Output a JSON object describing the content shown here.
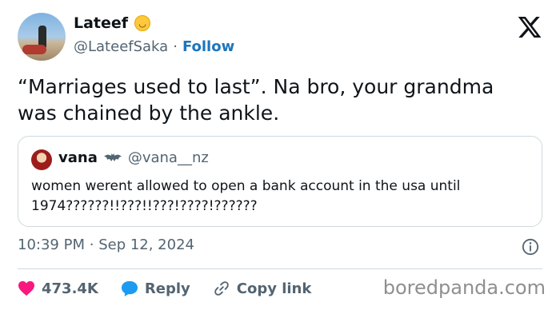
{
  "author": {
    "name": "Lateef",
    "emoji": "upside-down-face-emoji",
    "handle": "@LateefSaka",
    "separator": "·",
    "follow_label": "Follow"
  },
  "tweet": {
    "text": "“Marriages used to last”. Na bro, your grandma was chained by the ankle."
  },
  "quoted": {
    "name": "vana",
    "badge": "bat-emoji",
    "handle": "@vana__nz",
    "text": "women werent allowed to open a bank account in the usa until 1974??????!!???!!???!????!??????"
  },
  "meta": {
    "time": "10:39 PM",
    "separator": "·",
    "date": "Sep 12, 2024"
  },
  "actions": {
    "like_count": "473.4K",
    "reply_label": "Reply",
    "copy_label": "Copy link"
  },
  "watermark": "boredpanda.com",
  "colors": {
    "like": "#f91880",
    "reply": "#1d9bf0",
    "follow": "#1d75bb",
    "secondary_text": "#536471"
  }
}
